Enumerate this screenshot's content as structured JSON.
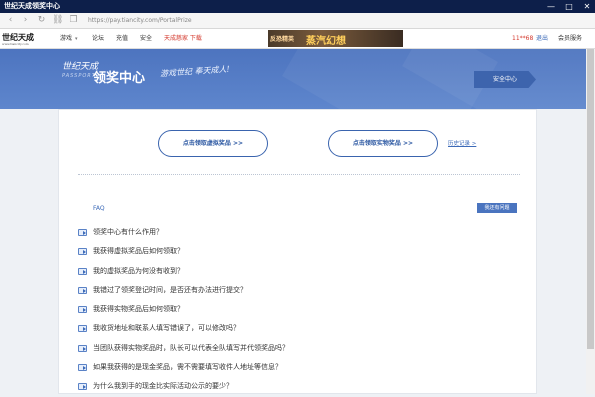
{
  "window": {
    "title": "世纪天成领奖中心",
    "min": "—",
    "max": "□",
    "close": "✕"
  },
  "address_bar": {
    "url": "https://pay.tiancity.com/PortalPrize"
  },
  "topnav": {
    "logo": "世纪天成",
    "logo_sub": "www.tiancity.com",
    "links": [
      "游戏",
      "论坛",
      "充值",
      "安全"
    ],
    "promo": "天成慈家 下载",
    "user": "11**68",
    "logout": "退出",
    "member": "会员服务"
  },
  "ad": {
    "tag": "反恐精英",
    "title": "蒸汽幻想"
  },
  "hero": {
    "brand": "世纪天成",
    "brand_sub": "PASSPORT",
    "heading": "领奖中心",
    "slogan": "游戏世纪 奉天成人!",
    "security_button": "安全中心"
  },
  "rewards": {
    "virtual_button": "点击领取虚拟奖品 >>",
    "physical_button": "点击领取实物奖品 >>",
    "history_link": "历史记录 >"
  },
  "faq": {
    "title": "FAQ",
    "ask_button": "我还有问题",
    "items": [
      "领奖中心有什么作用？",
      "我获得虚拟奖品后如何领取？",
      "我的虚拟奖品为何没有收到？",
      "我错过了领奖登记时间，是否还有办法进行提交？",
      "我获得实物奖品后如何领取？",
      "我收货地址和联系人填写错误了，可以修改吗？",
      "当团队获得实物奖品时，队长可以代表全队填写并代领奖品吗？",
      "如果我获得的是现金奖品，需不需要填写收件人地址等信息？",
      "为什么我到手的现金比实际活动公示的要少？"
    ]
  }
}
